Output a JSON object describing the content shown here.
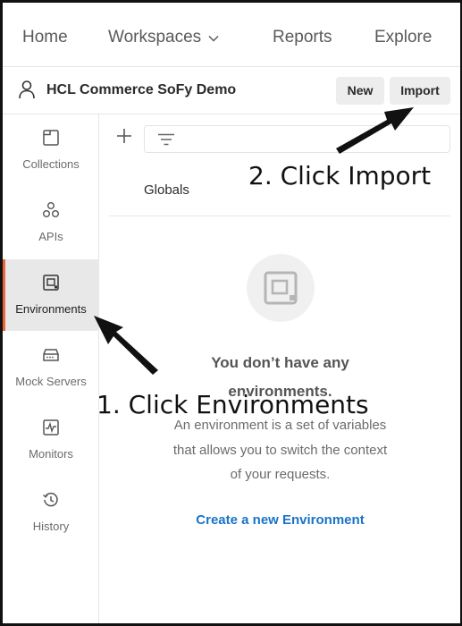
{
  "topnav": {
    "home": "Home",
    "workspaces": "Workspaces",
    "reports": "Reports",
    "explore": "Explore"
  },
  "workspace": {
    "title": "HCL Commerce SoFy Demo",
    "new_label": "New",
    "import_label": "Import"
  },
  "sidebar": {
    "items": [
      {
        "label": "Collections",
        "icon": "collections-icon"
      },
      {
        "label": "APIs",
        "icon": "apis-icon"
      },
      {
        "label": "Environments",
        "icon": "environments-icon",
        "active": true
      },
      {
        "label": "Mock Servers",
        "icon": "mock-servers-icon"
      },
      {
        "label": "Monitors",
        "icon": "monitors-icon"
      },
      {
        "label": "History",
        "icon": "history-icon"
      }
    ]
  },
  "content": {
    "globals": "Globals",
    "empty_title_line1": "You don’t have any",
    "empty_title_line2": "environments.",
    "empty_desc_line1": "An environment is a set of variables",
    "empty_desc_line2": "that allows you to switch the context",
    "empty_desc_line3": "of your requests.",
    "create_link": "Create a new Environment"
  },
  "annotations": {
    "step2": "2. Click Import",
    "step1": "1. Click Environments"
  },
  "colors": {
    "accent": "#e8673c",
    "link": "#1a73c8",
    "active_bg": "#e8e8e8"
  }
}
